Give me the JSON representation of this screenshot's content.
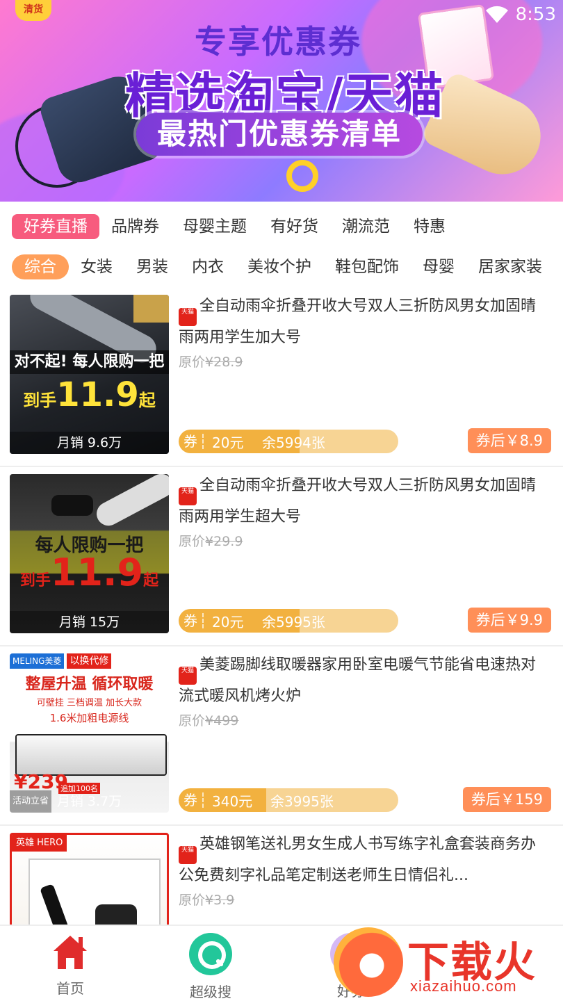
{
  "status": {
    "time": "8:53"
  },
  "banner": {
    "corner_tag": "清货",
    "line1": "专享优惠券",
    "line2": "精选淘宝/天猫",
    "line3": "最热门优惠券清单"
  },
  "tabs": [
    "好券直播",
    "品牌券",
    "母婴主题",
    "有好货",
    "潮流范",
    "特惠"
  ],
  "categories": [
    "综合",
    "女装",
    "男装",
    "内衣",
    "美妆个护",
    "鞋包配饰",
    "母婴",
    "居家家装"
  ],
  "tmall_badge": "天猫",
  "products": [
    {
      "title": "全自动雨伞折叠开收大号双人三折防风男女加固晴雨两用学生加大号",
      "orig_label": "原价",
      "orig_price": "¥28.9",
      "sales": "月销 9.6万",
      "coupon_label": "券",
      "coupon_amount": "20元",
      "coupon_left": "余5994张",
      "coupon_fill": 0.55,
      "after_price": "券后￥8.9",
      "img_line1": "对不起! 每人限购一把",
      "img_line2": "到手",
      "img_line3": "11.9",
      "img_line4": "起"
    },
    {
      "title": "全自动雨伞折叠开收大号双人三折防风男女加固晴雨两用学生超大号",
      "orig_label": "原价",
      "orig_price": "¥29.9",
      "sales": "月销 15万",
      "coupon_label": "券",
      "coupon_amount": "20元",
      "coupon_left": "余5995张",
      "coupon_fill": 0.55,
      "after_price": "券后￥9.9",
      "img_line1": "每人限购一把",
      "img_line2": "到手",
      "img_line3": "11.9",
      "img_line4": "起"
    },
    {
      "title": "美菱踢脚线取暖器家用卧室电暖气节能省电速热对流式暖风机烤火炉",
      "orig_label": "原价",
      "orig_price": "¥499",
      "sales": "月销 3.7万",
      "coupon_label": "券",
      "coupon_amount": "340元",
      "coupon_left": "余3995张",
      "coupon_fill": 0.4,
      "after_price": "券后￥159",
      "img_brand": "MELING美菱",
      "img_tag": "以换代修",
      "img_line1": "整屋升温 循环取暖",
      "img_line2": "可壁挂  三档调温  加长大款",
      "img_line3": "1.6米加粗电源线",
      "img_price": "¥239",
      "img_price_note": "追加100名",
      "img_activity": "活动立省"
    },
    {
      "title": "英雄钢笔送礼男女生成人书写练字礼盒套装商务办公免费刻字礼品笔定制送老师生日情侣礼...",
      "orig_label": "原价",
      "orig_price": "¥3.9",
      "img_brand": "英雄 HERO"
    }
  ],
  "nav": [
    {
      "label": "首页",
      "icon": "home-icon"
    },
    {
      "label": "超级搜",
      "icon": "search-icon"
    },
    {
      "label": "好券",
      "icon": "coupon-icon"
    }
  ],
  "watermark": {
    "big": "下载火",
    "small": "xiazaihuo.com"
  },
  "colors": {
    "tab_active": "#f75b7e",
    "cat_active": "#ff9f5a",
    "coupon": "#f2b13f",
    "after": "#ff8f58",
    "search_green": "#22c79a",
    "home_red": "#e02c2c"
  }
}
